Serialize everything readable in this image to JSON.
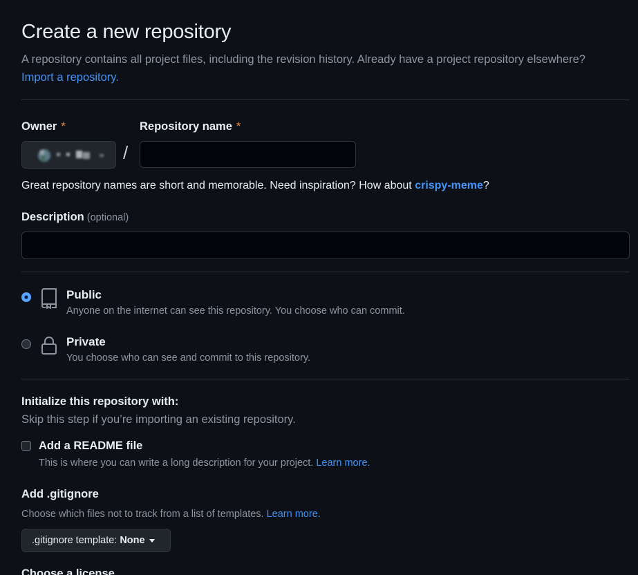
{
  "header": {
    "title": "Create a new repository",
    "subtitle": "A repository contains all project files, including the revision history. Already have a project repository elsewhere?",
    "import_link": "Import a repository."
  },
  "owner": {
    "label": "Owner",
    "required_marker": "*"
  },
  "repo_name": {
    "label": "Repository name",
    "required_marker": "*",
    "value": "",
    "separator": "/"
  },
  "name_hint": {
    "text": "Great repository names are short and memorable. Need inspiration? How about ",
    "suggestion": "crispy-meme",
    "suffix": "?"
  },
  "description": {
    "label": "Description",
    "optional": "(optional)",
    "value": ""
  },
  "visibility": {
    "public": {
      "title": "Public",
      "desc": "Anyone on the internet can see this repository. You choose who can commit.",
      "selected": true
    },
    "private": {
      "title": "Private",
      "desc": "You choose who can see and commit to this repository.",
      "selected": false
    }
  },
  "initialize": {
    "title": "Initialize this repository with:",
    "subtitle": "Skip this step if you’re importing an existing repository.",
    "readme": {
      "label": "Add a README file",
      "desc": "This is where you can write a long description for your project.",
      "learn_more": "Learn more.",
      "checked": false
    }
  },
  "gitignore": {
    "title": "Add .gitignore",
    "desc": "Choose which files not to track from a list of templates.",
    "learn_more": "Learn more.",
    "dropdown_label": ".gitignore template:",
    "dropdown_value": "None"
  },
  "license": {
    "title": "Choose a license"
  },
  "colors": {
    "background": "#0d1117",
    "link": "#4493f8",
    "required": "#f0883e",
    "muted": "#8d96a0"
  }
}
